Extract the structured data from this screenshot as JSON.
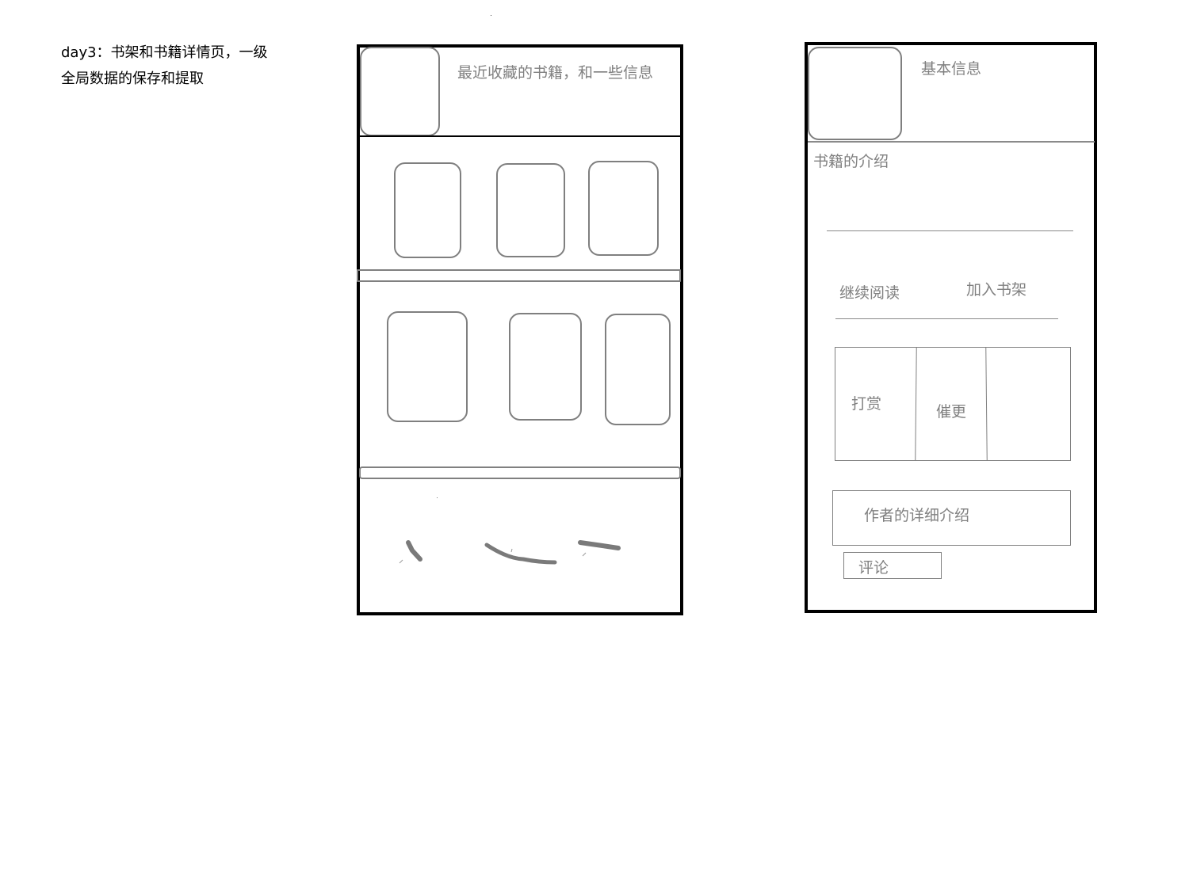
{
  "notes": {
    "line1": "day3：书架和书籍详情页，一级",
    "line2": "全局数据的保存和提取"
  },
  "bookshelf": {
    "recent_info": "最近收藏的书籍，和一些信息",
    "books_row_1": [
      "book",
      "book",
      "book"
    ],
    "books_row_2": [
      "book",
      "book",
      "book"
    ]
  },
  "detail": {
    "basic_info": "基本信息",
    "intro": "书籍的介绍",
    "continue_reading": "继续阅读",
    "add_to_shelf": "加入书架",
    "reward": "打赏",
    "urge_update": "催更",
    "author_intro": "作者的详细介绍",
    "comment": "评论"
  },
  "colors": {
    "frame": "#000000",
    "sketch_gray": "#808080"
  }
}
